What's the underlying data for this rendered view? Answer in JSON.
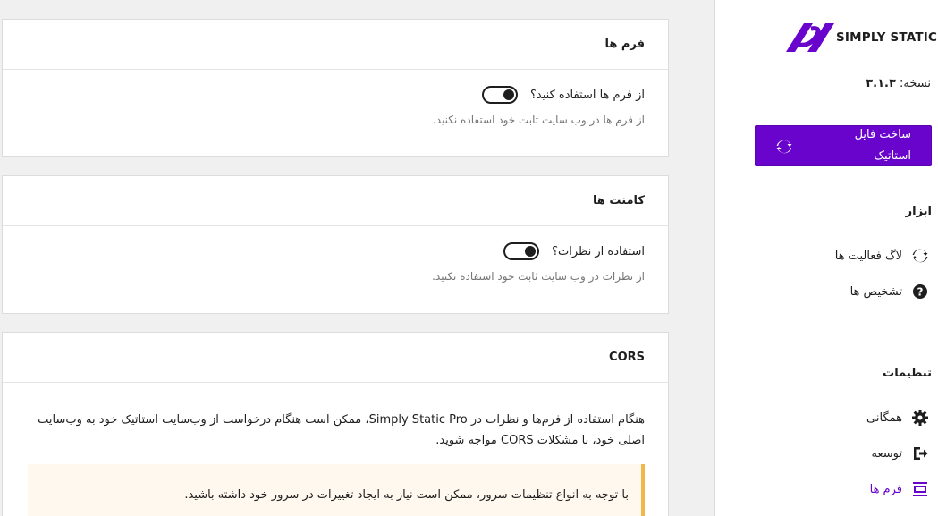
{
  "sidebar": {
    "logo_text": "SIMPLY STATIC",
    "version_label": "نسخه:",
    "version_value": "۳.۱.۳",
    "generate_button": "ساخت فایل استاتیک",
    "tools_title": "ابزار",
    "tools": [
      {
        "label": "لاگ فعالیت ها",
        "icon": "sync-icon"
      },
      {
        "label": "تشخیص ها",
        "icon": "help-circle-icon"
      }
    ],
    "settings_title": "تنظیمات",
    "settings": [
      {
        "label": "همگانی",
        "icon": "gear-icon"
      },
      {
        "label": "توسعه",
        "icon": "export-icon"
      },
      {
        "label": "فرم ها",
        "icon": "form-icon"
      }
    ],
    "accent_color": "#6804cc"
  },
  "forms_card": {
    "title": "فرم ها",
    "toggle_label": "از فرم ها استفاده کنید؟",
    "toggle_on": true,
    "help": "از فرم ها در وب سایت ثابت خود استفاده نکنید."
  },
  "comments_card": {
    "title": "کامنت ها",
    "toggle_label": "استفاده از نظرات؟",
    "toggle_on": true,
    "help": "از نظرات در وب سایت ثابت خود استفاده نکنید."
  },
  "cors_card": {
    "title": "CORS",
    "body": "هنگام استفاده از فرم‌ها و نظرات در Simply Static Pro، ممکن است هنگام درخواست از وب‌سایت استاتیک خود به وب‌سایت اصلی خود، با مشکلات CORS مواجه شوید.",
    "notice": "با توجه به انواع تنظیمات سرور، ممکن است نیاز به ایجاد تغییرات در سرور خود داشته باشید."
  }
}
